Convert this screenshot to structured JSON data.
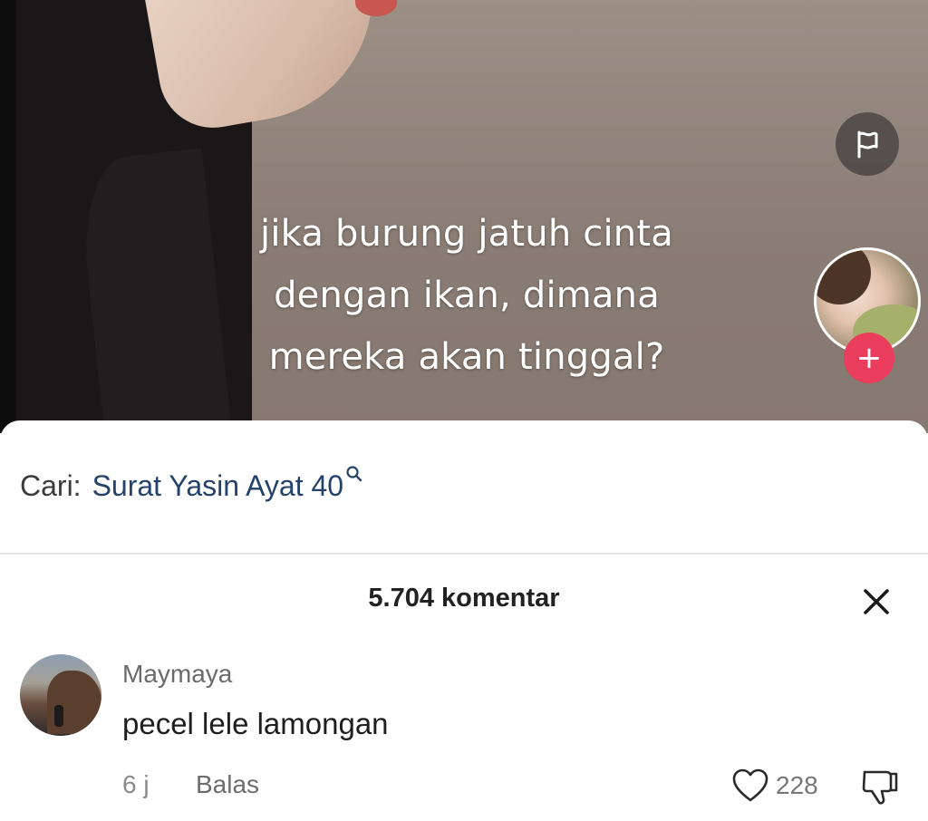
{
  "video": {
    "caption_lines": [
      "jika burung jatuh cinta",
      "dengan ikan, dimana",
      "mereka akan tinggal?"
    ],
    "icons": {
      "flag": "flag-icon",
      "follow": "plus-icon"
    },
    "follow_label": "+"
  },
  "search": {
    "prefix": "Cari:",
    "query": "Surat Yasin Ayat 40",
    "icon": "search-icon",
    "query_color": "#25426b"
  },
  "comments": {
    "title": "5.704 komentar",
    "close_icon": "close-icon",
    "items": [
      {
        "username": "Maymaya",
        "text": "pecel lele lamongan",
        "time": "6 j",
        "reply_label": "Balas",
        "likes": "228"
      }
    ]
  },
  "colors": {
    "accent": "#ea3d5d",
    "text": "#1e1e1e",
    "muted": "#8b8b8b"
  }
}
